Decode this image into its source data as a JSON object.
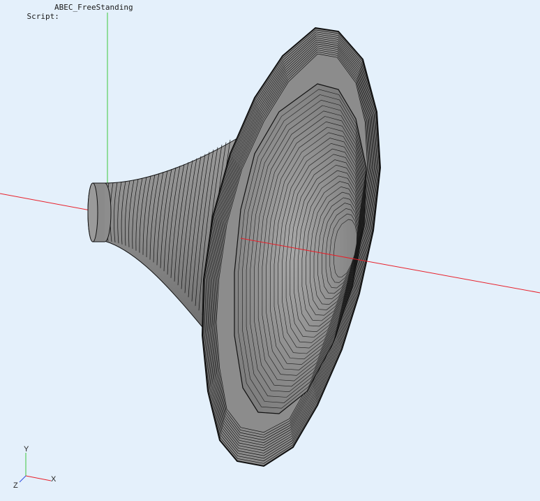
{
  "script": {
    "label": "Script:",
    "name": "ABEC_FreeStanding"
  },
  "triad": {
    "x_label": "X",
    "y_label": "Y",
    "z_label": "Z"
  },
  "colors": {
    "background": "#e4f0fb",
    "x_axis": "#e8202a",
    "y_axis": "#3ec93e",
    "mesh_fill": "#8e8e8e",
    "mesh_lines": "#111111"
  }
}
